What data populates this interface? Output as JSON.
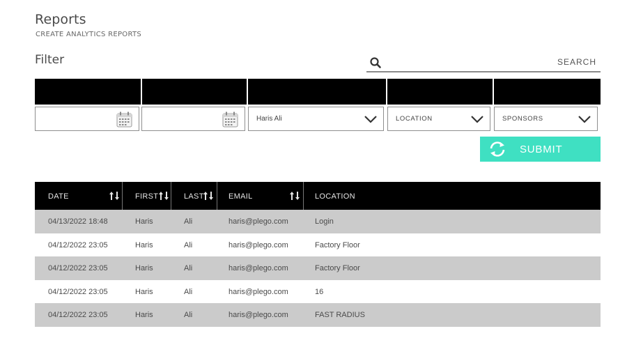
{
  "header": {
    "title": "Reports",
    "subtitle": "CREATE ANALYTICS REPORTS"
  },
  "filter": {
    "label": "Filter",
    "search_placeholder": "SEARCH",
    "date_from": "",
    "date_to": "",
    "user_select": "Haris Ali",
    "location_select": "LOCATION",
    "sponsors_select": "SPONSORS",
    "submit_label": "SUBMIT"
  },
  "colors": {
    "accent": "#3fe0c2",
    "header_bg": "#000000",
    "row_alt": "#cbcbcb"
  },
  "icons": {
    "search": "search-icon",
    "calendar": "calendar-icon",
    "dropdown": "chevron-down-icon",
    "submit": "refresh-icon",
    "sort": "sort-icon"
  },
  "table": {
    "columns": [
      "DATE",
      "FIRST",
      "LAST",
      "EMAIL",
      "LOCATION"
    ],
    "rows": [
      [
        "04/13/2022 18:48",
        "Haris",
        "Ali",
        "haris@plego.com",
        "Login"
      ],
      [
        "04/12/2022 23:05",
        "Haris",
        "Ali",
        "haris@plego.com",
        "Factory Floor"
      ],
      [
        "04/12/2022 23:05",
        "Haris",
        "Ali",
        "haris@plego.com",
        "Factory Floor"
      ],
      [
        "04/12/2022 23:05",
        "Haris",
        "Ali",
        "haris@plego.com",
        "16"
      ],
      [
        "04/12/2022 23:05",
        "Haris",
        "Ali",
        "haris@plego.com",
        "FAST RADIUS"
      ]
    ]
  }
}
